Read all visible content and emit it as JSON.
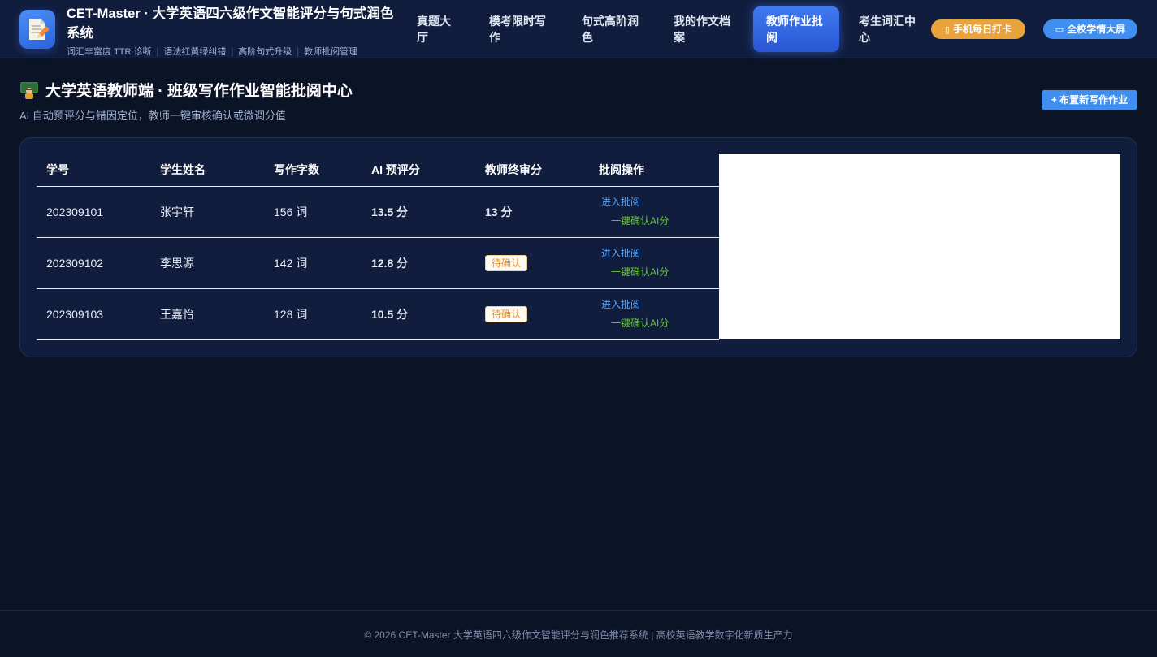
{
  "header": {
    "brand_title": "CET-Master · 大学英语四六级作文智能评分与句式润色系统",
    "brand_tags": [
      "词汇丰富度 TTR 诊断",
      "语法红黄绿纠错",
      "高阶句式升级",
      "教师批阅管理"
    ],
    "nav": [
      {
        "label": "真题大厅"
      },
      {
        "label": "模考限时写作"
      },
      {
        "label": "句式高阶润色"
      },
      {
        "label": "我的作文档案"
      },
      {
        "label": "教师作业批阅",
        "active": true
      },
      {
        "label": "考生词汇中心"
      }
    ],
    "checkin_label": "手机每日打卡",
    "screen_label": "全校学情大屏"
  },
  "page": {
    "title": "大学英语教师端 · 班级写作作业智能批阅中心",
    "subtitle": "AI 自动预评分与错因定位，教师一键审核确认或微调分值",
    "new_assignment_label": "+ 布置新写作作业"
  },
  "table": {
    "columns": [
      "学号",
      "学生姓名",
      "写作字数",
      "AI 预评分",
      "教师终审分",
      "批阅操作"
    ],
    "rows": [
      {
        "id": "202309101",
        "name": "张宇轩",
        "words": "156 词",
        "ai_score": "13.5 分",
        "final": "13 分",
        "pending": false
      },
      {
        "id": "202309102",
        "name": "李思源",
        "words": "142 词",
        "ai_score": "12.8 分",
        "final": "待确认",
        "pending": true
      },
      {
        "id": "202309103",
        "name": "王嘉怡",
        "words": "128 词",
        "ai_score": "10.5 分",
        "final": "待确认",
        "pending": true
      }
    ],
    "op_review": "进入批阅",
    "op_confirm": "一键确认AI分"
  },
  "footer": {
    "text": "© 2026 CET-Master 大学英语四六级作文智能评分与润色推荐系统 | 高校英语教学数字化新质生产力"
  },
  "colors": {
    "background": "#0b1327",
    "header": "#111d3d",
    "accent_blue": "#3f8ef0",
    "ai_score": "#3fa0f5",
    "final_score": "#34c27c",
    "pending": "#e0913a",
    "confirm_green": "#67c23a",
    "orange_pill": "#e8a33d"
  },
  "icons": {
    "logo": "document-pencil-icon",
    "checkin": "phone-icon",
    "screen": "monitor-icon",
    "title": "teacher-icon"
  }
}
